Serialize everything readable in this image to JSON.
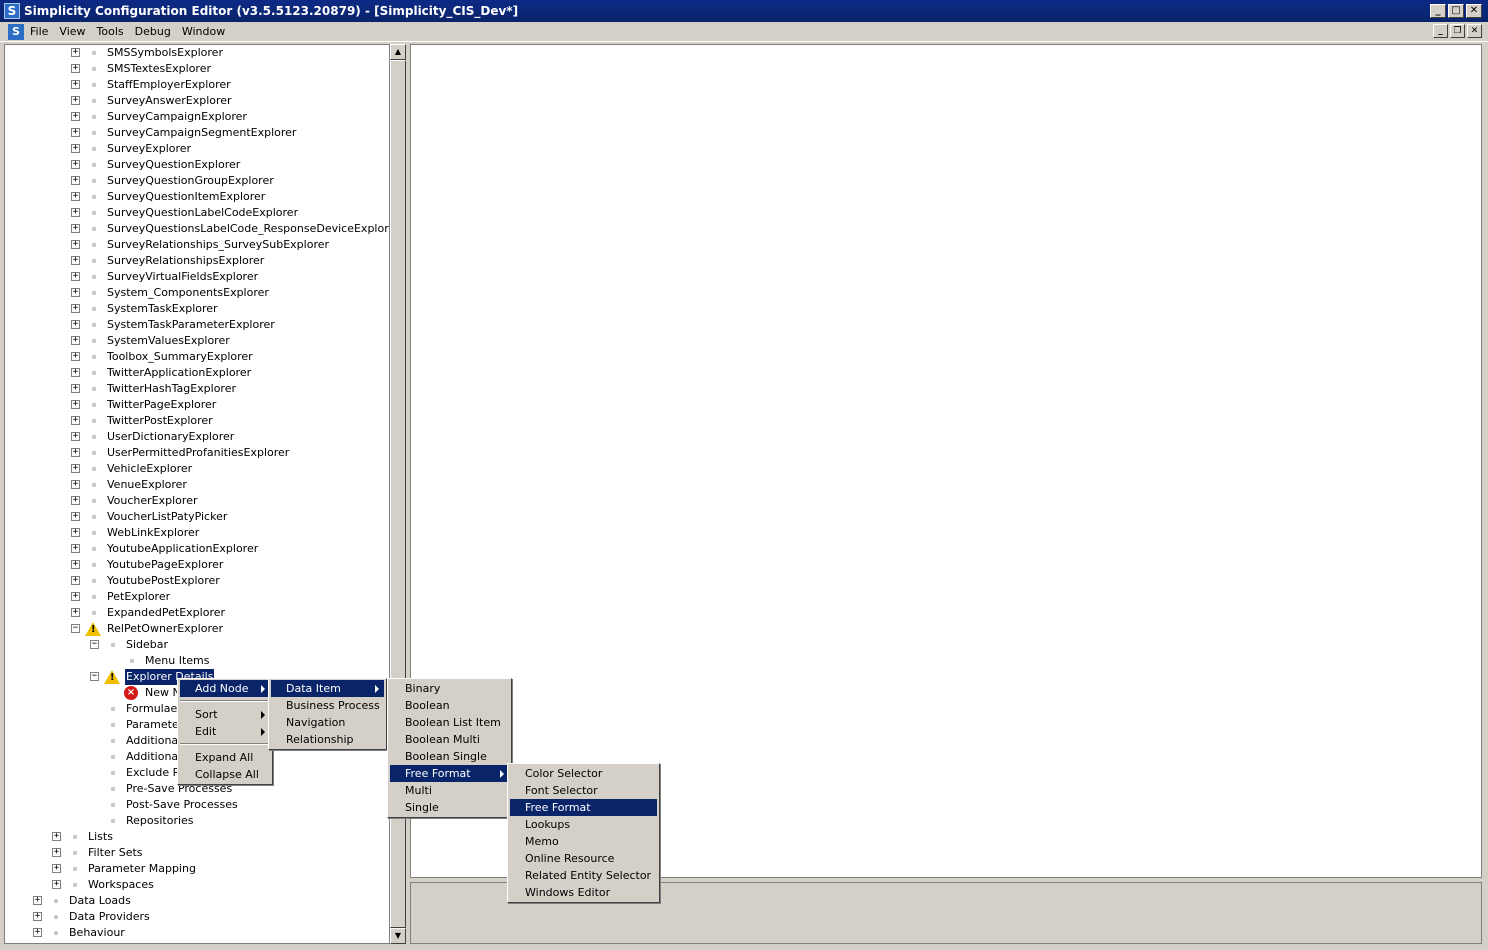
{
  "window": {
    "title": "Simplicity Configuration Editor (v3.5.5123.20879) - [Simplicity_CIS_Dev*]",
    "app_icon": "S",
    "buttons": {
      "minimize": "_",
      "maximize": "□",
      "close": "✕"
    },
    "mdi_buttons": {
      "minimize": "_",
      "restore": "❐",
      "close": "✕"
    }
  },
  "menubar": {
    "items": [
      "File",
      "View",
      "Tools",
      "Debug",
      "Window"
    ]
  },
  "tree": {
    "explorers": [
      "SMSSymbolsExplorer",
      "SMSTextesExplorer",
      "StaffEmployerExplorer",
      "SurveyAnswerExplorer",
      "SurveyCampaignExplorer",
      "SurveyCampaignSegmentExplorer",
      "SurveyExplorer",
      "SurveyQuestionExplorer",
      "SurveyQuestionGroupExplorer",
      "SurveyQuestionItemExplorer",
      "SurveyQuestionLabelCodeExplorer",
      "SurveyQuestionsLabelCode_ResponseDeviceExplorer",
      "SurveyRelationships_SurveySubExplorer",
      "SurveyRelationshipsExplorer",
      "SurveyVirtualFieldsExplorer",
      "System_ComponentsExplorer",
      "SystemTaskExplorer",
      "SystemTaskParameterExplorer",
      "SystemValuesExplorer",
      "Toolbox_SummaryExplorer",
      "TwitterApplicationExplorer",
      "TwitterHashTagExplorer",
      "TwitterPageExplorer",
      "TwitterPostExplorer",
      "UserDictionaryExplorer",
      "UserPermittedProfanitiesExplorer",
      "VehicleExplorer",
      "VenueExplorer",
      "VoucherExplorer",
      "VoucherListPatyPicker",
      "WebLinkExplorer",
      "YoutubeApplicationExplorer",
      "YoutubePageExplorer",
      "YoutubePostExplorer",
      "PetExplorer",
      "ExpandedPetExplorer"
    ],
    "rel_explorer": "RelPetOwnerExplorer",
    "sidebar": "Sidebar",
    "menu_items": "Menu Items",
    "explorer_details": "Explorer Details",
    "new_node": "New N",
    "detail_children": [
      "Formulae",
      "Parameters",
      "Additional",
      "Additional",
      "Exclude R",
      "Pre-Save Processes",
      "Post-Save Processes",
      "Repositories"
    ],
    "level2": [
      "Lists",
      "Filter Sets",
      "Parameter Mapping",
      "Workspaces"
    ],
    "level1": [
      "Data Loads",
      "Data Providers",
      "Behaviour"
    ],
    "expand_glyph": "+",
    "collapse_glyph": "−"
  },
  "context_menu": {
    "add_node": "Add Node",
    "sort": "Sort",
    "edit": "Edit",
    "expand_all": "Expand All",
    "collapse_all": "Collapse All"
  },
  "add_node_menu": {
    "items": [
      "Data Item",
      "Business Process",
      "Navigation",
      "Relationship"
    ]
  },
  "data_item_menu": {
    "items": [
      "Binary",
      "Boolean",
      "Boolean List Item",
      "Boolean Multi",
      "Boolean Single",
      "Free Format",
      "Multi",
      "Single"
    ]
  },
  "free_format_menu": {
    "items": [
      "Color Selector",
      "Font Selector",
      "Free Format",
      "Lookups",
      "Memo",
      "Online Resource",
      "Related Entity Selector",
      "Windows Editor"
    ]
  },
  "colors": {
    "selection": "#0a246a",
    "face": "#d4d0c8",
    "warning": "#f0c000",
    "error": "#d31818"
  }
}
